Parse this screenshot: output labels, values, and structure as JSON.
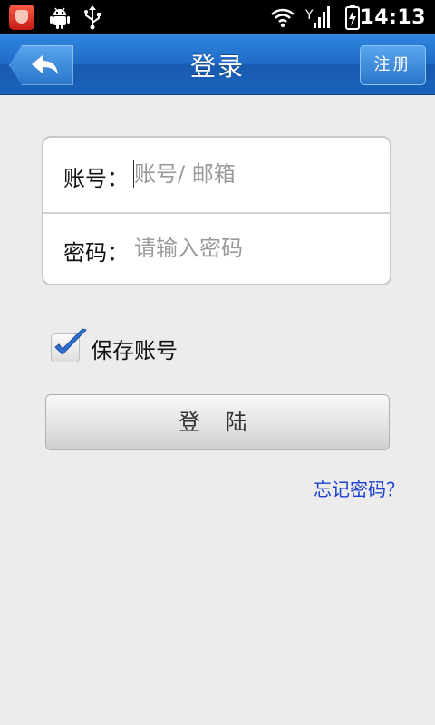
{
  "status_bar": {
    "time": "14:13",
    "icons": [
      "app-icon",
      "android-debug-icon",
      "usb-icon",
      "wifi-icon",
      "signal-icon",
      "battery-charging-icon"
    ]
  },
  "header": {
    "title": "登录",
    "back_icon": "back-arrow-icon",
    "register_label": "注册",
    "accent_color": "#1f6cc8"
  },
  "form": {
    "account_label": "账号：",
    "account_placeholder": "账号/ 邮箱",
    "account_value": "",
    "password_label": "密码：",
    "password_placeholder": "请输入密码",
    "password_value": ""
  },
  "remember": {
    "label": "保存账号",
    "checked": true
  },
  "login_button": "登 陆",
  "forgot_link": "忘记密码？"
}
